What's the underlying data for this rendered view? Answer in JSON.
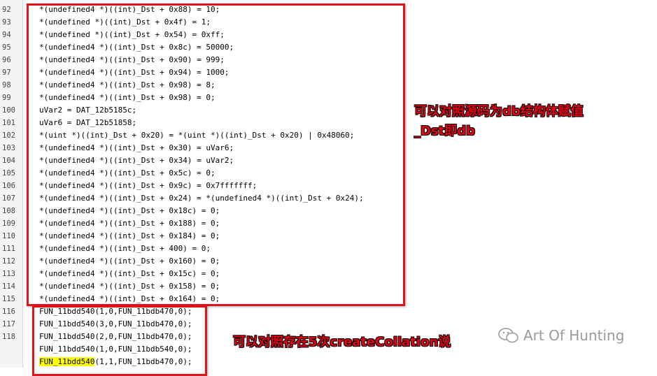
{
  "lines": [
    {
      "n": "92",
      "t": "*(undefined4 *)((int)_Dst + 0x88) = 10;"
    },
    {
      "n": "93",
      "t": "*(undefined *)((int)_Dst + 0x4f) = 1;"
    },
    {
      "n": "94",
      "t": "*(undefined *)((int)_Dst + 0x54) = 0xff;"
    },
    {
      "n": "95",
      "t": "*(undefined4 *)((int)_Dst + 0x8c) = 50000;"
    },
    {
      "n": "96",
      "t": "*(undefined4 *)((int)_Dst + 0x90) = 999;"
    },
    {
      "n": "97",
      "t": "*(undefined4 *)((int)_Dst + 0x94) = 1000;"
    },
    {
      "n": "98",
      "t": "*(undefined4 *)((int)_Dst + 0x98) = 8;"
    },
    {
      "n": "99",
      "t": "*(undefined4 *)((int)_Dst + 0x98) = 0;"
    },
    {
      "n": "100",
      "t": "uVar2 = DAT_12b5185c;"
    },
    {
      "n": "101",
      "t": "uVar6 = DAT_12b51858;"
    },
    {
      "n": "102",
      "t": "*(uint *)((int)_Dst + 0x20) = *(uint *)((int)_Dst + 0x20) | 0x48060;"
    },
    {
      "n": "103",
      "t": "*(undefined4 *)((int)_Dst + 0x30) = uVar6;"
    },
    {
      "n": "104",
      "t": "*(undefined4 *)((int)_Dst + 0x34) = uVar2;"
    },
    {
      "n": "105",
      "t": "*(undefined4 *)((int)_Dst + 0x5c) = 0;"
    },
    {
      "n": "106",
      "t": "*(undefined4 *)((int)_Dst + 0x9c) = 0x7fffffff;"
    },
    {
      "n": "107",
      "t": "*(undefined4 *)((int)_Dst + 0x24) = *(undefined4 *)((int)_Dst + 0x24);"
    },
    {
      "n": "108",
      "t": "*(undefined4 *)((int)_Dst + 0x18c) = 0;"
    },
    {
      "n": "109",
      "t": "*(undefined4 *)((int)_Dst + 0x188) = 0;"
    },
    {
      "n": "110",
      "t": "*(undefined4 *)((int)_Dst + 0x184) = 0;"
    },
    {
      "n": "111",
      "t": "*(undefined4 *)((int)_Dst + 400) = 0;"
    },
    {
      "n": "112",
      "t": "*(undefined4 *)((int)_Dst + 0x160) = 0;"
    },
    {
      "n": "113",
      "t": "*(undefined4 *)((int)_Dst + 0x15c) = 0;"
    },
    {
      "n": "114",
      "t": "*(undefined4 *)((int)_Dst + 0x158) = 0;"
    },
    {
      "n": "115",
      "t": "*(undefined4 *)((int)_Dst + 0x164) = 0;"
    },
    {
      "n": "116",
      "t": "FUN_11bdd540(1,0,FUN_11bdb470,0);"
    },
    {
      "n": "117",
      "t": "FUN_11bdd540(3,0,FUN_11bdb470,0);"
    },
    {
      "n": "118",
      "t": "FUN_11bdd540(2,0,FUN_11bdb470,0);"
    },
    {
      "n": "",
      "t": "FUN_11bdd540(1,0,FUN_11bdb540,0);"
    },
    {
      "n": "",
      "t": "FUN_11bdd540(1,1,FUN_11bdb470,0);"
    }
  ],
  "highlight_prefix": "FUN_11bdd540",
  "annotation_top_line1": "可以对照源码为db结构体赋值",
  "annotation_top_line2": "_Dst即db",
  "annotation_bottom": "可以对照存在5次createCollation说",
  "watermark": "Art Of Hunting",
  "colors": {
    "box": "#e0141b",
    "annotation": "#e60012",
    "highlight": "#ffff00"
  }
}
